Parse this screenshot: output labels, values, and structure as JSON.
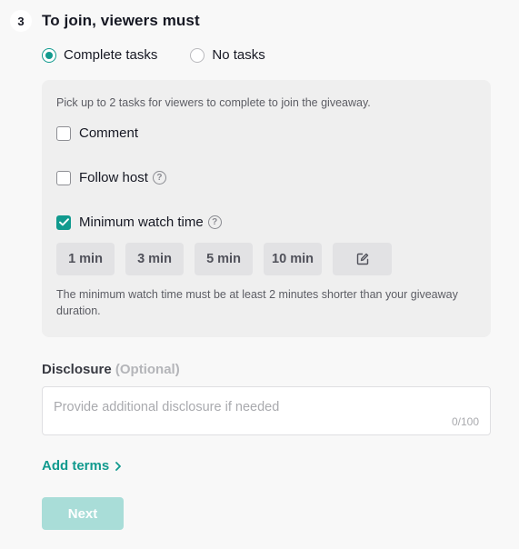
{
  "step": {
    "number": "3",
    "title": "To join, viewers must"
  },
  "join_mode": {
    "options": [
      {
        "label": "Complete tasks",
        "selected": true
      },
      {
        "label": "No tasks",
        "selected": false
      }
    ]
  },
  "tasks": {
    "hint": "Pick up to 2 tasks for viewers to complete to join the giveaway.",
    "items": [
      {
        "label": "Comment",
        "checked": false,
        "has_help": false
      },
      {
        "label": "Follow host",
        "checked": false,
        "has_help": true
      },
      {
        "label": "Minimum watch time",
        "checked": true,
        "has_help": true
      }
    ],
    "time_options": [
      "1 min",
      "3 min",
      "5 min",
      "10 min"
    ],
    "custom_time_icon": "edit-icon",
    "note": "The minimum watch time must be at least 2 minutes shorter than your giveaway duration."
  },
  "disclosure": {
    "label": "Disclosure",
    "optional": "(Optional)",
    "placeholder": "Provide additional disclosure if needed",
    "value": "",
    "char_count": "0/100"
  },
  "add_terms": {
    "label": "Add terms"
  },
  "next_button": {
    "label": "Next",
    "disabled": true
  },
  "colors": {
    "accent": "#119a8e",
    "accent_disabled": "#a9ddd8",
    "panel_bg": "#efefef",
    "page_bg": "#f8f8f8"
  }
}
